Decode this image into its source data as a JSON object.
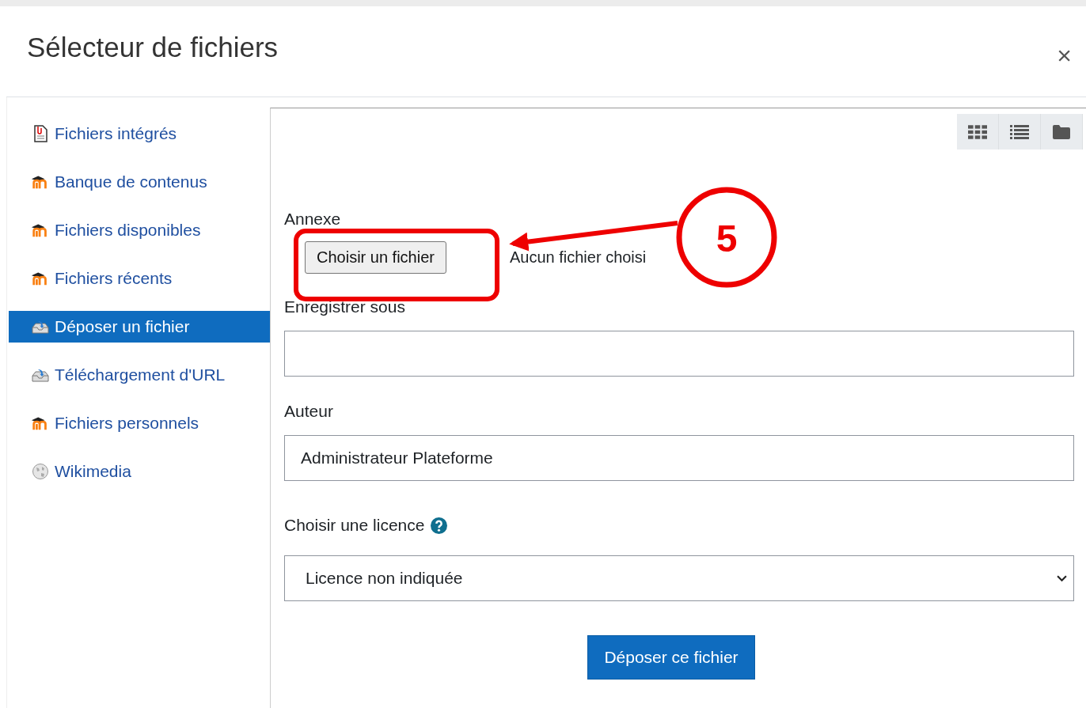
{
  "dialog": {
    "title": "Sélecteur de fichiers",
    "close": "×"
  },
  "sidebar": {
    "items": [
      {
        "label": "Fichiers intégrés",
        "kind": "document",
        "selected": false
      },
      {
        "label": "Banque de contenus",
        "kind": "moodle",
        "selected": false
      },
      {
        "label": "Fichiers disponibles",
        "kind": "moodle",
        "selected": false
      },
      {
        "label": "Fichiers récents",
        "kind": "moodle",
        "selected": false
      },
      {
        "label": "Déposer un fichier",
        "kind": "upload",
        "selected": true
      },
      {
        "label": "Téléchargement d'URL",
        "kind": "upload",
        "selected": false
      },
      {
        "label": "Fichiers personnels",
        "kind": "moodle",
        "selected": false
      },
      {
        "label": "Wikimedia",
        "kind": "globe",
        "selected": false
      }
    ]
  },
  "view_buttons": [
    {
      "kind": "grid"
    },
    {
      "kind": "list"
    },
    {
      "kind": "folder"
    }
  ],
  "form": {
    "attachment_label": "Annexe",
    "choose_button": "Choisir un fichier",
    "file_status": "Aucun fichier choisi",
    "save_as_label": "Enregistrer sous",
    "author_label": "Auteur",
    "author_value": "Administrateur Plateforme",
    "license_label": "Choisir une licence",
    "license_value": "Licence non indiquée",
    "submit": "Déposer ce fichier"
  },
  "annotation": {
    "number": "5"
  }
}
